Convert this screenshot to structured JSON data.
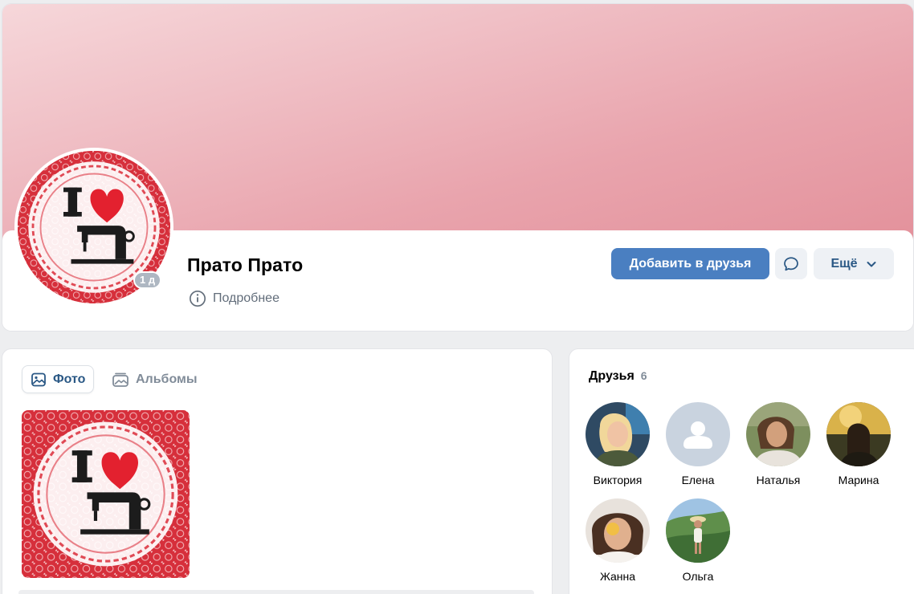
{
  "profile": {
    "name": "Прато Прато",
    "online_badge": "1 д",
    "more_info_label": "Подробнее",
    "add_friend_label": "Добавить в друзья",
    "more_label": "Ещё"
  },
  "photos": {
    "tabs": [
      {
        "label": "Фото",
        "active": true,
        "icon": "photo-icon"
      },
      {
        "label": "Альбомы",
        "active": false,
        "icon": "albums-icon"
      }
    ]
  },
  "friends": {
    "title": "Друзья",
    "count": "6",
    "items": [
      {
        "name": "Виктория"
      },
      {
        "name": "Елена"
      },
      {
        "name": "Наталья"
      },
      {
        "name": "Марина"
      },
      {
        "name": "Жанна"
      },
      {
        "name": "Ольга"
      }
    ]
  },
  "colors": {
    "accent": "#4a7fc1",
    "link": "#2a5885",
    "cover_start": "#f6d7da",
    "cover_end": "#e3919b"
  }
}
